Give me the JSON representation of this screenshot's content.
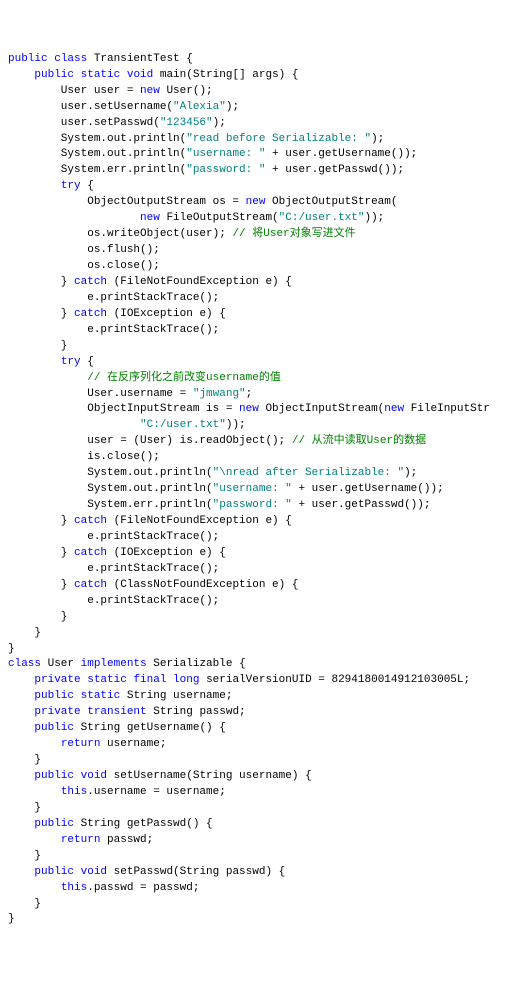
{
  "lines": [
    {
      "parts": [
        {
          "t": "public ",
          "c": "kw"
        },
        {
          "t": "class ",
          "c": "kw"
        },
        {
          "t": "TransientTest {",
          "c": "type"
        }
      ]
    },
    {
      "parts": [
        {
          "t": "",
          "c": ""
        }
      ]
    },
    {
      "parts": [
        {
          "t": "    ",
          "c": ""
        },
        {
          "t": "public ",
          "c": "kw"
        },
        {
          "t": "static ",
          "c": "kw"
        },
        {
          "t": "void ",
          "c": "kw"
        },
        {
          "t": "main(String[] args) {",
          "c": "type"
        }
      ]
    },
    {
      "parts": [
        {
          "t": "",
          "c": ""
        }
      ]
    },
    {
      "parts": [
        {
          "t": "        User user = ",
          "c": "type"
        },
        {
          "t": "new ",
          "c": "kw"
        },
        {
          "t": "User();",
          "c": "type"
        }
      ]
    },
    {
      "parts": [
        {
          "t": "        user.setUsername(",
          "c": "type"
        },
        {
          "t": "\"Alexia\"",
          "c": "str"
        },
        {
          "t": ");",
          "c": "type"
        }
      ]
    },
    {
      "parts": [
        {
          "t": "        user.setPasswd(",
          "c": "type"
        },
        {
          "t": "\"123456\"",
          "c": "str"
        },
        {
          "t": ");",
          "c": "type"
        }
      ]
    },
    {
      "parts": [
        {
          "t": "",
          "c": ""
        }
      ]
    },
    {
      "parts": [
        {
          "t": "        System.out.println(",
          "c": "type"
        },
        {
          "t": "\"read before Serializable: \"",
          "c": "str"
        },
        {
          "t": ");",
          "c": "type"
        }
      ]
    },
    {
      "parts": [
        {
          "t": "        System.out.println(",
          "c": "type"
        },
        {
          "t": "\"username: \"",
          "c": "str"
        },
        {
          "t": " + user.getUsername());",
          "c": "type"
        }
      ]
    },
    {
      "parts": [
        {
          "t": "        System.err.println(",
          "c": "type"
        },
        {
          "t": "\"password: \"",
          "c": "str"
        },
        {
          "t": " + user.getPasswd());",
          "c": "type"
        }
      ]
    },
    {
      "parts": [
        {
          "t": "",
          "c": ""
        }
      ]
    },
    {
      "parts": [
        {
          "t": "        ",
          "c": ""
        },
        {
          "t": "try ",
          "c": "kw"
        },
        {
          "t": "{",
          "c": "type"
        }
      ]
    },
    {
      "parts": [
        {
          "t": "            ObjectOutputStream os = ",
          "c": "type"
        },
        {
          "t": "new ",
          "c": "kw"
        },
        {
          "t": "ObjectOutputStream(",
          "c": "type"
        }
      ]
    },
    {
      "parts": [
        {
          "t": "                    ",
          "c": ""
        },
        {
          "t": "new ",
          "c": "kw"
        },
        {
          "t": "FileOutputStream(",
          "c": "type"
        },
        {
          "t": "\"C:/user.txt\"",
          "c": "str"
        },
        {
          "t": "));",
          "c": "type"
        }
      ]
    },
    {
      "parts": [
        {
          "t": "            os.writeObject(user); ",
          "c": "type"
        },
        {
          "t": "// 将User对象写进文件",
          "c": "com-g"
        }
      ]
    },
    {
      "parts": [
        {
          "t": "            os.flush();",
          "c": "type"
        }
      ]
    },
    {
      "parts": [
        {
          "t": "            os.close();",
          "c": "type"
        }
      ]
    },
    {
      "parts": [
        {
          "t": "        } ",
          "c": "type"
        },
        {
          "t": "catch ",
          "c": "kw"
        },
        {
          "t": "(FileNotFoundException e) {",
          "c": "type"
        }
      ]
    },
    {
      "parts": [
        {
          "t": "            e.printStackTrace();",
          "c": "type"
        }
      ]
    },
    {
      "parts": [
        {
          "t": "        } ",
          "c": "type"
        },
        {
          "t": "catch ",
          "c": "kw"
        },
        {
          "t": "(IOException e) {",
          "c": "type"
        }
      ]
    },
    {
      "parts": [
        {
          "t": "            e.printStackTrace();",
          "c": "type"
        }
      ]
    },
    {
      "parts": [
        {
          "t": "        }",
          "c": "type"
        }
      ]
    },
    {
      "parts": [
        {
          "t": "        ",
          "c": ""
        },
        {
          "t": "try ",
          "c": "kw"
        },
        {
          "t": "{",
          "c": "type"
        }
      ]
    },
    {
      "parts": [
        {
          "t": "            ",
          "c": ""
        },
        {
          "t": "// 在反序列化之前改变username的值",
          "c": "com-g"
        }
      ]
    },
    {
      "parts": [
        {
          "t": "            User.username = ",
          "c": "type"
        },
        {
          "t": "\"jmwang\"",
          "c": "str"
        },
        {
          "t": ";",
          "c": "type"
        }
      ]
    },
    {
      "parts": [
        {
          "t": "",
          "c": ""
        }
      ]
    },
    {
      "parts": [
        {
          "t": "            ObjectInputStream is = ",
          "c": "type"
        },
        {
          "t": "new ",
          "c": "kw"
        },
        {
          "t": "ObjectInputStream(",
          "c": "type"
        },
        {
          "t": "new ",
          "c": "kw"
        },
        {
          "t": "FileInputStr",
          "c": "type"
        }
      ]
    },
    {
      "parts": [
        {
          "t": "                    ",
          "c": ""
        },
        {
          "t": "\"C:/user.txt\"",
          "c": "str"
        },
        {
          "t": "));",
          "c": "type"
        }
      ]
    },
    {
      "parts": [
        {
          "t": "            user = (User) is.readObject(); ",
          "c": "type"
        },
        {
          "t": "// 从流中读取User的数据",
          "c": "com-g"
        }
      ]
    },
    {
      "parts": [
        {
          "t": "            is.close();",
          "c": "type"
        }
      ]
    },
    {
      "parts": [
        {
          "t": "",
          "c": ""
        }
      ]
    },
    {
      "parts": [
        {
          "t": "            System.out.println(",
          "c": "type"
        },
        {
          "t": "\"\\nread after Serializable: \"",
          "c": "str"
        },
        {
          "t": ");",
          "c": "type"
        }
      ]
    },
    {
      "parts": [
        {
          "t": "            System.out.println(",
          "c": "type"
        },
        {
          "t": "\"username: \"",
          "c": "str"
        },
        {
          "t": " + user.getUsername());",
          "c": "type"
        }
      ]
    },
    {
      "parts": [
        {
          "t": "            System.err.println(",
          "c": "type"
        },
        {
          "t": "\"password: \"",
          "c": "str"
        },
        {
          "t": " + user.getPasswd());",
          "c": "type"
        }
      ]
    },
    {
      "parts": [
        {
          "t": "",
          "c": ""
        }
      ]
    },
    {
      "parts": [
        {
          "t": "        } ",
          "c": "type"
        },
        {
          "t": "catch ",
          "c": "kw"
        },
        {
          "t": "(FileNotFoundException e) {",
          "c": "type"
        }
      ]
    },
    {
      "parts": [
        {
          "t": "            e.printStackTrace();",
          "c": "type"
        }
      ]
    },
    {
      "parts": [
        {
          "t": "        } ",
          "c": "type"
        },
        {
          "t": "catch ",
          "c": "kw"
        },
        {
          "t": "(IOException e) {",
          "c": "type"
        }
      ]
    },
    {
      "parts": [
        {
          "t": "            e.printStackTrace();",
          "c": "type"
        }
      ]
    },
    {
      "parts": [
        {
          "t": "        } ",
          "c": "type"
        },
        {
          "t": "catch ",
          "c": "kw"
        },
        {
          "t": "(ClassNotFoundException e) {",
          "c": "type"
        }
      ]
    },
    {
      "parts": [
        {
          "t": "            e.printStackTrace();",
          "c": "type"
        }
      ]
    },
    {
      "parts": [
        {
          "t": "        }",
          "c": "type"
        }
      ]
    },
    {
      "parts": [
        {
          "t": "    }",
          "c": "type"
        }
      ]
    },
    {
      "parts": [
        {
          "t": "}",
          "c": "type"
        }
      ]
    },
    {
      "parts": [
        {
          "t": "",
          "c": ""
        }
      ]
    },
    {
      "parts": [
        {
          "t": "class ",
          "c": "kw"
        },
        {
          "t": "User ",
          "c": "type"
        },
        {
          "t": "implements ",
          "c": "kw"
        },
        {
          "t": "Serializable {",
          "c": "type"
        }
      ]
    },
    {
      "parts": [
        {
          "t": "    ",
          "c": ""
        },
        {
          "t": "private ",
          "c": "kw"
        },
        {
          "t": "static ",
          "c": "kw"
        },
        {
          "t": "final ",
          "c": "kw"
        },
        {
          "t": "long ",
          "c": "kw"
        },
        {
          "t": "serialVersionUID = 8294180014912103005L;",
          "c": "type"
        }
      ]
    },
    {
      "parts": [
        {
          "t": "",
          "c": ""
        }
      ]
    },
    {
      "parts": [
        {
          "t": "    ",
          "c": ""
        },
        {
          "t": "public ",
          "c": "kw"
        },
        {
          "t": "static ",
          "c": "kw"
        },
        {
          "t": "String username;",
          "c": "type"
        }
      ]
    },
    {
      "parts": [
        {
          "t": "    ",
          "c": ""
        },
        {
          "t": "private ",
          "c": "kw"
        },
        {
          "t": "transient ",
          "c": "kw"
        },
        {
          "t": "String passwd;",
          "c": "type"
        }
      ]
    },
    {
      "parts": [
        {
          "t": "",
          "c": ""
        }
      ]
    },
    {
      "parts": [
        {
          "t": "    ",
          "c": ""
        },
        {
          "t": "public ",
          "c": "kw"
        },
        {
          "t": "String getUsername() {",
          "c": "type"
        }
      ]
    },
    {
      "parts": [
        {
          "t": "        ",
          "c": ""
        },
        {
          "t": "return ",
          "c": "kw"
        },
        {
          "t": "username;",
          "c": "type"
        }
      ]
    },
    {
      "parts": [
        {
          "t": "    }",
          "c": "type"
        }
      ]
    },
    {
      "parts": [
        {
          "t": "",
          "c": ""
        }
      ]
    },
    {
      "parts": [
        {
          "t": "    ",
          "c": ""
        },
        {
          "t": "public ",
          "c": "kw"
        },
        {
          "t": "void ",
          "c": "kw"
        },
        {
          "t": "setUsername(String username) {",
          "c": "type"
        }
      ]
    },
    {
      "parts": [
        {
          "t": "        ",
          "c": ""
        },
        {
          "t": "this",
          "c": "kw"
        },
        {
          "t": ".username = username;",
          "c": "type"
        }
      ]
    },
    {
      "parts": [
        {
          "t": "    }",
          "c": "type"
        }
      ]
    },
    {
      "parts": [
        {
          "t": "",
          "c": ""
        }
      ]
    },
    {
      "parts": [
        {
          "t": "    ",
          "c": ""
        },
        {
          "t": "public ",
          "c": "kw"
        },
        {
          "t": "String getPasswd() {",
          "c": "type"
        }
      ]
    },
    {
      "parts": [
        {
          "t": "        ",
          "c": ""
        },
        {
          "t": "return ",
          "c": "kw"
        },
        {
          "t": "passwd;",
          "c": "type"
        }
      ]
    },
    {
      "parts": [
        {
          "t": "    }",
          "c": "type"
        }
      ]
    },
    {
      "parts": [
        {
          "t": "",
          "c": ""
        }
      ]
    },
    {
      "parts": [
        {
          "t": "    ",
          "c": ""
        },
        {
          "t": "public ",
          "c": "kw"
        },
        {
          "t": "void ",
          "c": "kw"
        },
        {
          "t": "setPasswd(String passwd) {",
          "c": "type"
        }
      ]
    },
    {
      "parts": [
        {
          "t": "        ",
          "c": ""
        },
        {
          "t": "this",
          "c": "kw"
        },
        {
          "t": ".passwd = passwd;",
          "c": "type"
        }
      ]
    },
    {
      "parts": [
        {
          "t": "    }",
          "c": "type"
        }
      ]
    },
    {
      "parts": [
        {
          "t": "",
          "c": ""
        }
      ]
    },
    {
      "parts": [
        {
          "t": "}",
          "c": "type"
        }
      ]
    }
  ]
}
